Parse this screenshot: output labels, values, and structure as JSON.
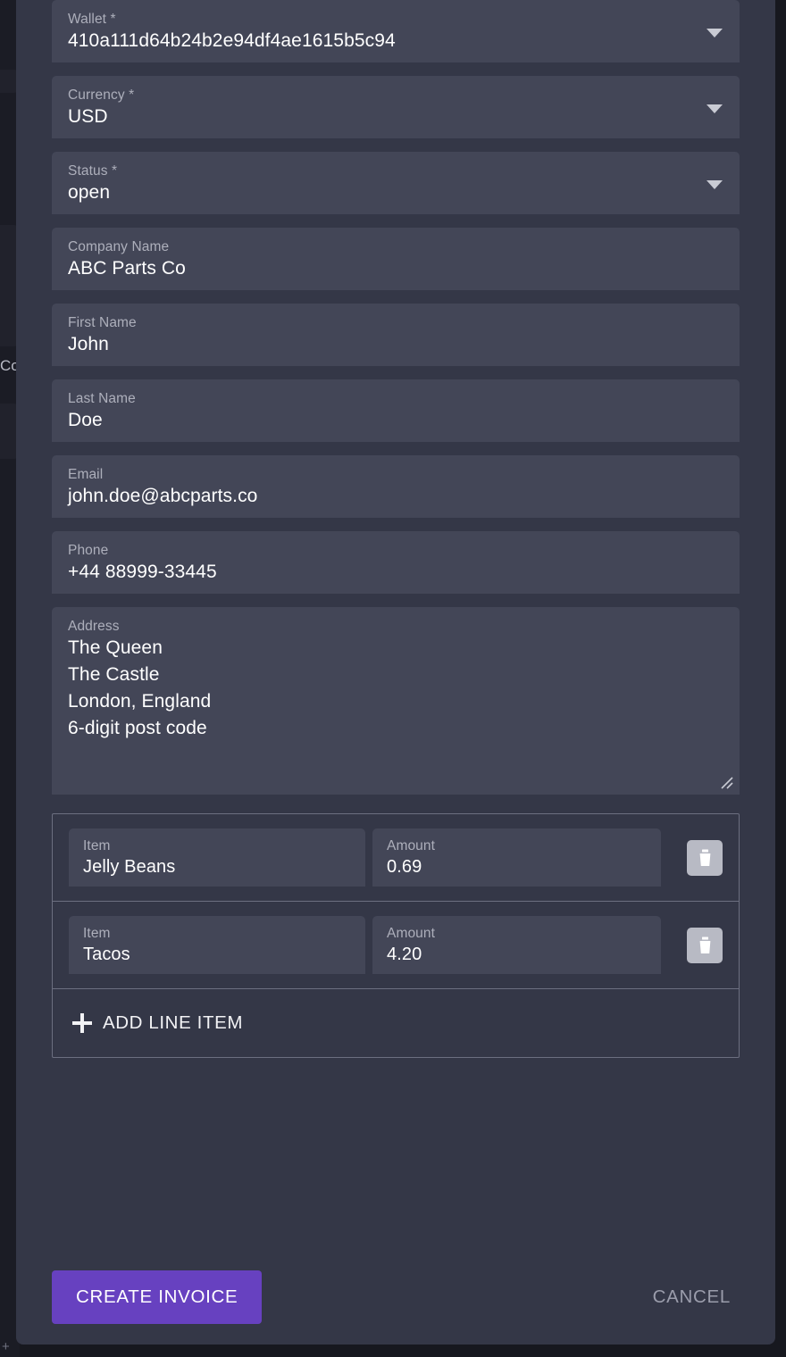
{
  "background": {
    "clipped_text": "Co",
    "plus_glyph": "+"
  },
  "dialog": {
    "fields": [
      {
        "label": "Wallet *",
        "value": "410a111d64b24b2e94df4ae1615b5c94",
        "type": "select"
      },
      {
        "label": "Currency *",
        "value": "USD",
        "type": "select"
      },
      {
        "label": "Status *",
        "value": "open",
        "type": "select"
      },
      {
        "label": "Company Name",
        "value": "ABC Parts Co",
        "type": "text"
      },
      {
        "label": "First Name",
        "value": "John",
        "type": "text"
      },
      {
        "label": "Last Name",
        "value": "Doe",
        "type": "text"
      },
      {
        "label": "Email",
        "value": "john.doe@abcparts.co",
        "type": "text"
      },
      {
        "label": "Phone",
        "value": "+44 88999-33445",
        "type": "text"
      }
    ],
    "address": {
      "label": "Address",
      "value": "The Queen\nThe Castle\nLondon, England\n6-digit post code"
    },
    "line_items": {
      "item_label": "Item",
      "amount_label": "Amount",
      "rows": [
        {
          "item": "Jelly Beans",
          "amount": "0.69"
        },
        {
          "item": "Tacos",
          "amount": "4.20"
        }
      ],
      "add_label": "ADD LINE ITEM"
    },
    "footer": {
      "submit_label": "CREATE INVOICE",
      "cancel_label": "CANCEL"
    },
    "colors": {
      "accent": "#6741c0",
      "dialog_bg": "#343747",
      "field_bg": "#434657",
      "page_bg": "#17181f"
    }
  }
}
